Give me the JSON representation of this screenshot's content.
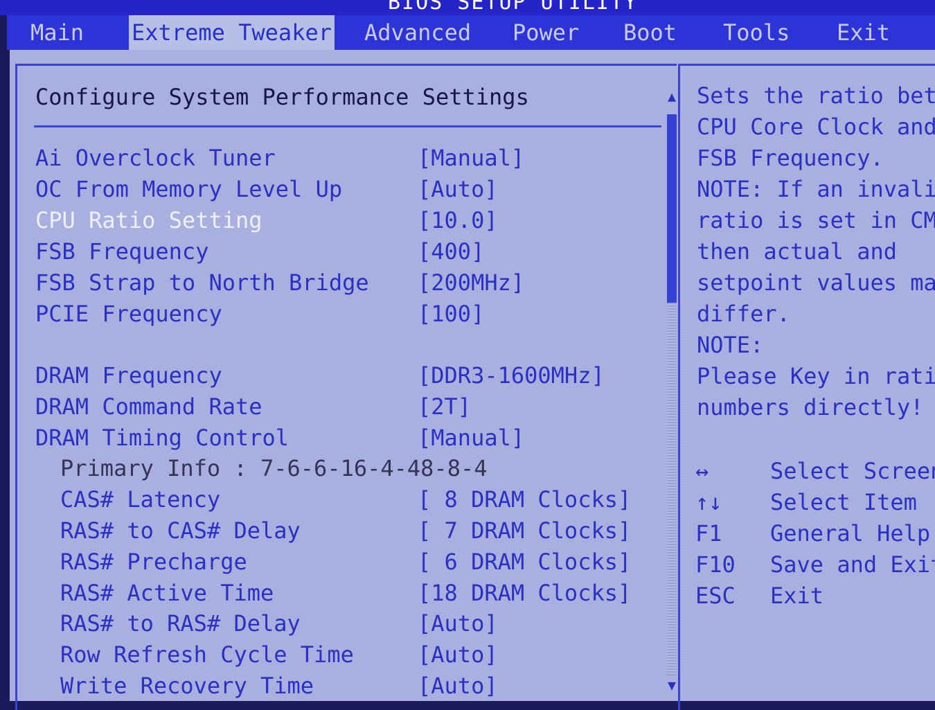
{
  "title": "BIOS SETUP UTILITY",
  "menu": [
    {
      "label": "Main"
    },
    {
      "label": "Extreme Tweaker"
    },
    {
      "label": "Advanced"
    },
    {
      "label": "Power"
    },
    {
      "label": "Boot"
    },
    {
      "label": "Tools"
    },
    {
      "label": "Exit"
    }
  ],
  "main": {
    "heading": "Configure System Performance Settings",
    "settings": [
      {
        "label": "Ai Overclock Tuner",
        "value": "[Manual]"
      },
      {
        "label": "OC From Memory Level Up",
        "value": "[Auto]"
      },
      {
        "label": "CPU Ratio Setting",
        "value": "[10.0]"
      },
      {
        "label": "FSB Frequency",
        "value": "[400]"
      },
      {
        "label": "FSB Strap to North Bridge",
        "value": "[200MHz]"
      },
      {
        "label": "PCIE Frequency",
        "value": "[100]"
      },
      {
        "label": "DRAM Frequency",
        "value": "[DDR3-1600MHz]"
      },
      {
        "label": "DRAM Command Rate",
        "value": "[2T]"
      },
      {
        "label": "DRAM Timing Control",
        "value": "[Manual]"
      },
      {
        "label": "Primary Info : 7-6-6-16-4-48-8-4",
        "value": ""
      },
      {
        "label": "CAS# Latency",
        "value": "[ 8 DRAM Clocks]"
      },
      {
        "label": "RAS# to CAS# Delay",
        "value": "[ 7 DRAM Clocks]"
      },
      {
        "label": "RAS# Precharge",
        "value": "[ 6 DRAM Clocks]"
      },
      {
        "label": "RAS# Active Time",
        "value": "[18 DRAM Clocks]"
      },
      {
        "label": "RAS# to RAS# Delay",
        "value": "[Auto]"
      },
      {
        "label": "Row Refresh Cycle Time",
        "value": "[Auto]"
      },
      {
        "label": "Write Recovery Time",
        "value": "[Auto]"
      }
    ]
  },
  "help": {
    "lines": [
      "Sets the ratio betw",
      "CPU Core Clock and",
      "FSB Frequency.",
      "NOTE: If an invalid",
      "ratio is set in CMO",
      "then actual and",
      "setpoint values may",
      "differ.",
      "NOTE:",
      "Please Key in ratio",
      "numbers directly!"
    ],
    "keys": [
      {
        "key": "↔",
        "action": "Select Screen"
      },
      {
        "key": "↑↓",
        "action": "Select Item"
      },
      {
        "key": "F1",
        "action": "General Help"
      },
      {
        "key": "F10",
        "action": "Save and Exit"
      },
      {
        "key": "ESC",
        "action": "Exit"
      }
    ]
  },
  "scrollbar": {
    "up_arrow": "▲",
    "down_arrow": "▼"
  },
  "colors": {
    "background": "#a9b0df",
    "accent": "#2a30c4",
    "selected_text": "#eef0ff",
    "menu_bar": "#2c34d8"
  }
}
